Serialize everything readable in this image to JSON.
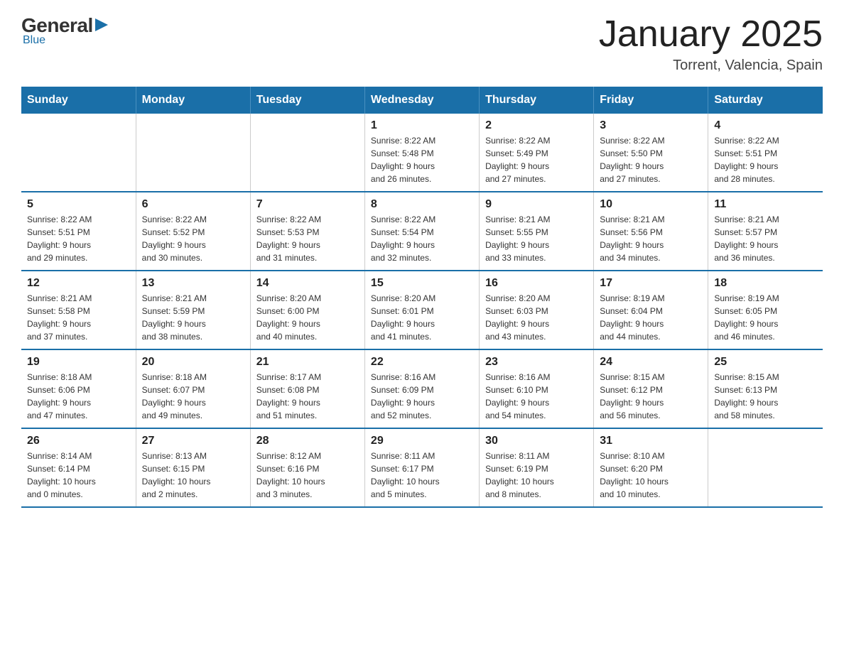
{
  "logo": {
    "general": "General",
    "blue": "Blue",
    "tagline": "Blue"
  },
  "title": "January 2025",
  "location": "Torrent, Valencia, Spain",
  "days_of_week": [
    "Sunday",
    "Monday",
    "Tuesday",
    "Wednesday",
    "Thursday",
    "Friday",
    "Saturday"
  ],
  "weeks": [
    [
      {
        "day": "",
        "info": ""
      },
      {
        "day": "",
        "info": ""
      },
      {
        "day": "",
        "info": ""
      },
      {
        "day": "1",
        "info": "Sunrise: 8:22 AM\nSunset: 5:48 PM\nDaylight: 9 hours\nand 26 minutes."
      },
      {
        "day": "2",
        "info": "Sunrise: 8:22 AM\nSunset: 5:49 PM\nDaylight: 9 hours\nand 27 minutes."
      },
      {
        "day": "3",
        "info": "Sunrise: 8:22 AM\nSunset: 5:50 PM\nDaylight: 9 hours\nand 27 minutes."
      },
      {
        "day": "4",
        "info": "Sunrise: 8:22 AM\nSunset: 5:51 PM\nDaylight: 9 hours\nand 28 minutes."
      }
    ],
    [
      {
        "day": "5",
        "info": "Sunrise: 8:22 AM\nSunset: 5:51 PM\nDaylight: 9 hours\nand 29 minutes."
      },
      {
        "day": "6",
        "info": "Sunrise: 8:22 AM\nSunset: 5:52 PM\nDaylight: 9 hours\nand 30 minutes."
      },
      {
        "day": "7",
        "info": "Sunrise: 8:22 AM\nSunset: 5:53 PM\nDaylight: 9 hours\nand 31 minutes."
      },
      {
        "day": "8",
        "info": "Sunrise: 8:22 AM\nSunset: 5:54 PM\nDaylight: 9 hours\nand 32 minutes."
      },
      {
        "day": "9",
        "info": "Sunrise: 8:21 AM\nSunset: 5:55 PM\nDaylight: 9 hours\nand 33 minutes."
      },
      {
        "day": "10",
        "info": "Sunrise: 8:21 AM\nSunset: 5:56 PM\nDaylight: 9 hours\nand 34 minutes."
      },
      {
        "day": "11",
        "info": "Sunrise: 8:21 AM\nSunset: 5:57 PM\nDaylight: 9 hours\nand 36 minutes."
      }
    ],
    [
      {
        "day": "12",
        "info": "Sunrise: 8:21 AM\nSunset: 5:58 PM\nDaylight: 9 hours\nand 37 minutes."
      },
      {
        "day": "13",
        "info": "Sunrise: 8:21 AM\nSunset: 5:59 PM\nDaylight: 9 hours\nand 38 minutes."
      },
      {
        "day": "14",
        "info": "Sunrise: 8:20 AM\nSunset: 6:00 PM\nDaylight: 9 hours\nand 40 minutes."
      },
      {
        "day": "15",
        "info": "Sunrise: 8:20 AM\nSunset: 6:01 PM\nDaylight: 9 hours\nand 41 minutes."
      },
      {
        "day": "16",
        "info": "Sunrise: 8:20 AM\nSunset: 6:03 PM\nDaylight: 9 hours\nand 43 minutes."
      },
      {
        "day": "17",
        "info": "Sunrise: 8:19 AM\nSunset: 6:04 PM\nDaylight: 9 hours\nand 44 minutes."
      },
      {
        "day": "18",
        "info": "Sunrise: 8:19 AM\nSunset: 6:05 PM\nDaylight: 9 hours\nand 46 minutes."
      }
    ],
    [
      {
        "day": "19",
        "info": "Sunrise: 8:18 AM\nSunset: 6:06 PM\nDaylight: 9 hours\nand 47 minutes."
      },
      {
        "day": "20",
        "info": "Sunrise: 8:18 AM\nSunset: 6:07 PM\nDaylight: 9 hours\nand 49 minutes."
      },
      {
        "day": "21",
        "info": "Sunrise: 8:17 AM\nSunset: 6:08 PM\nDaylight: 9 hours\nand 51 minutes."
      },
      {
        "day": "22",
        "info": "Sunrise: 8:16 AM\nSunset: 6:09 PM\nDaylight: 9 hours\nand 52 minutes."
      },
      {
        "day": "23",
        "info": "Sunrise: 8:16 AM\nSunset: 6:10 PM\nDaylight: 9 hours\nand 54 minutes."
      },
      {
        "day": "24",
        "info": "Sunrise: 8:15 AM\nSunset: 6:12 PM\nDaylight: 9 hours\nand 56 minutes."
      },
      {
        "day": "25",
        "info": "Sunrise: 8:15 AM\nSunset: 6:13 PM\nDaylight: 9 hours\nand 58 minutes."
      }
    ],
    [
      {
        "day": "26",
        "info": "Sunrise: 8:14 AM\nSunset: 6:14 PM\nDaylight: 10 hours\nand 0 minutes."
      },
      {
        "day": "27",
        "info": "Sunrise: 8:13 AM\nSunset: 6:15 PM\nDaylight: 10 hours\nand 2 minutes."
      },
      {
        "day": "28",
        "info": "Sunrise: 8:12 AM\nSunset: 6:16 PM\nDaylight: 10 hours\nand 3 minutes."
      },
      {
        "day": "29",
        "info": "Sunrise: 8:11 AM\nSunset: 6:17 PM\nDaylight: 10 hours\nand 5 minutes."
      },
      {
        "day": "30",
        "info": "Sunrise: 8:11 AM\nSunset: 6:19 PM\nDaylight: 10 hours\nand 8 minutes."
      },
      {
        "day": "31",
        "info": "Sunrise: 8:10 AM\nSunset: 6:20 PM\nDaylight: 10 hours\nand 10 minutes."
      },
      {
        "day": "",
        "info": ""
      }
    ]
  ]
}
